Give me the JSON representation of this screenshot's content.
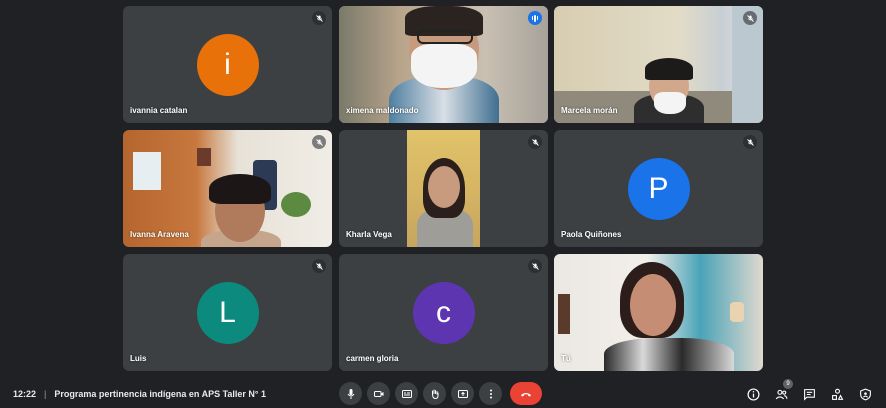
{
  "participants": [
    {
      "name": "ivannia catalan",
      "initial": "i",
      "avatar_color": "#e8710a",
      "muted": true
    },
    {
      "name": "ximena maldonado",
      "speaking": true
    },
    {
      "name": "Marcela morán",
      "muted": true
    },
    {
      "name": "Ivanna Aravena",
      "muted": true
    },
    {
      "name": "Kharla Vega",
      "muted": true
    },
    {
      "name": "Paola Quiñones",
      "initial": "P",
      "avatar_color": "#1a73e8",
      "muted": true
    },
    {
      "name": "Luis",
      "initial": "L",
      "avatar_color": "#0b8a7d",
      "muted": true
    },
    {
      "name": "carmen gloria",
      "initial": "c",
      "avatar_color": "#5e35b1",
      "muted": true
    },
    {
      "name": "Tú"
    }
  ],
  "meeting": {
    "time": "12:22",
    "separator": "|",
    "title": "Programa pertinencia indígena en APS Taller N° 1"
  },
  "controls": {
    "icons": [
      "mic-icon",
      "camera-icon",
      "captions-icon",
      "raise-hand-icon",
      "present-icon",
      "more-options-icon",
      "end-call-icon"
    ]
  },
  "right_tools": {
    "people_count": "9",
    "icons": [
      "info-icon",
      "people-icon",
      "chat-icon",
      "activities-icon",
      "host-controls-icon"
    ]
  },
  "colors": {
    "background": "#202124",
    "tile": "#3c4043",
    "speaking_outline": "#8ab4f8",
    "end_call": "#ea4335"
  }
}
